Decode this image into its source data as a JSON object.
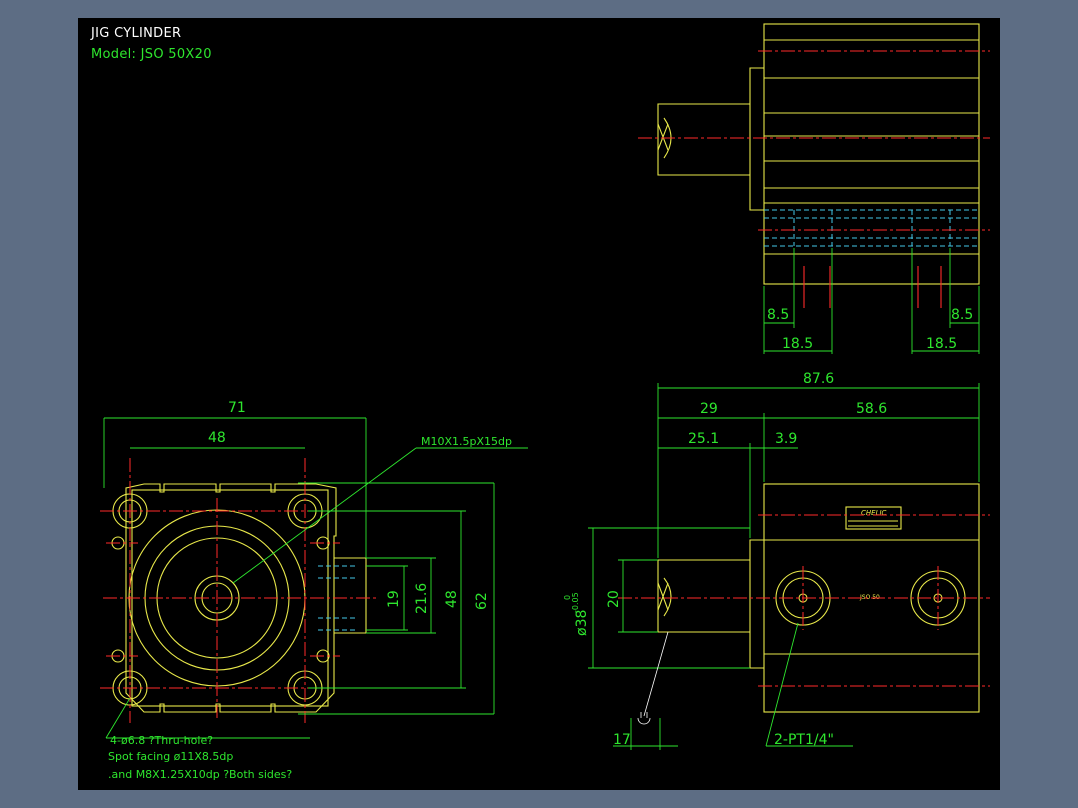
{
  "header": {
    "title": "JIG CYLINDER",
    "model": "Model:  JSO 50X20"
  },
  "colors": {
    "background_frame": "#5d6d84",
    "canvas": "#000000",
    "outline": "#e8e84a",
    "dimension": "#2ee62e",
    "centerline": "#ff2a2a",
    "hidden": "#43c7e8"
  },
  "front_view": {
    "dim_width_overall": "71",
    "dim_width_holes": "48",
    "dim_height_overall": "62",
    "dim_height_holes": "48",
    "dim_port_21": "21.6",
    "dim_port_19": "19",
    "thread_callout": "M10X1.5pX15dp",
    "note_line1": "4-ø6.8   ?Thru-hole?",
    "note_line2": "Spot facing  ø11X8.5dp",
    "note_line3": ".and M8X1.25X10dp ?Both sides?"
  },
  "top_view": {
    "dim_85_left": "8.5",
    "dim_85_right": "8.5",
    "dim_185_left": "18.5",
    "dim_185_right": "18.5"
  },
  "side_view": {
    "dim_total": "87.6",
    "dim_29": "29",
    "dim_586": "58.6",
    "dim_251": "25.1",
    "dim_39": "3.9",
    "dim_rod": "20",
    "dim_bore": "ø38",
    "tol_upper": "0",
    "tol_lower": "-0.05",
    "dim_17": "17",
    "port_callout": "2-PT1/4\"",
    "label_brand": "CHELIC",
    "label_tag": "JSO 50"
  }
}
